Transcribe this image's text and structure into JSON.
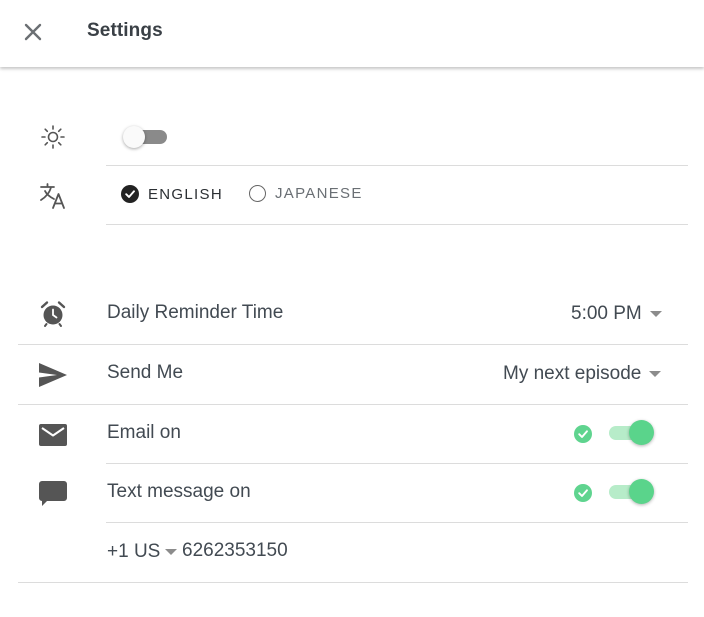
{
  "header": {
    "title": "Settings",
    "close_icon": "close-icon"
  },
  "theme": {
    "icon": "sun-icon",
    "dark_mode_on": false
  },
  "language": {
    "icon": "translate-icon",
    "options": [
      {
        "label": "ENGLISH",
        "selected": true
      },
      {
        "label": "JAPANESE",
        "selected": false
      }
    ]
  },
  "reminder": {
    "icon": "alarm-clock-icon",
    "label": "Daily Reminder Time",
    "value": "5:00 PM"
  },
  "send_me": {
    "icon": "send-icon",
    "label": "Send Me",
    "value": "My next episode"
  },
  "email": {
    "icon": "mail-icon",
    "label": "Email on",
    "enabled": true
  },
  "text_message": {
    "icon": "chat-bubble-icon",
    "label": "Text message on",
    "enabled": true
  },
  "phone": {
    "country_code": "+1 US",
    "number": "6262353150"
  },
  "colors": {
    "accent_green": "#5ad48b",
    "accent_green_light": "#b7ecc9",
    "text": "#424a52"
  }
}
